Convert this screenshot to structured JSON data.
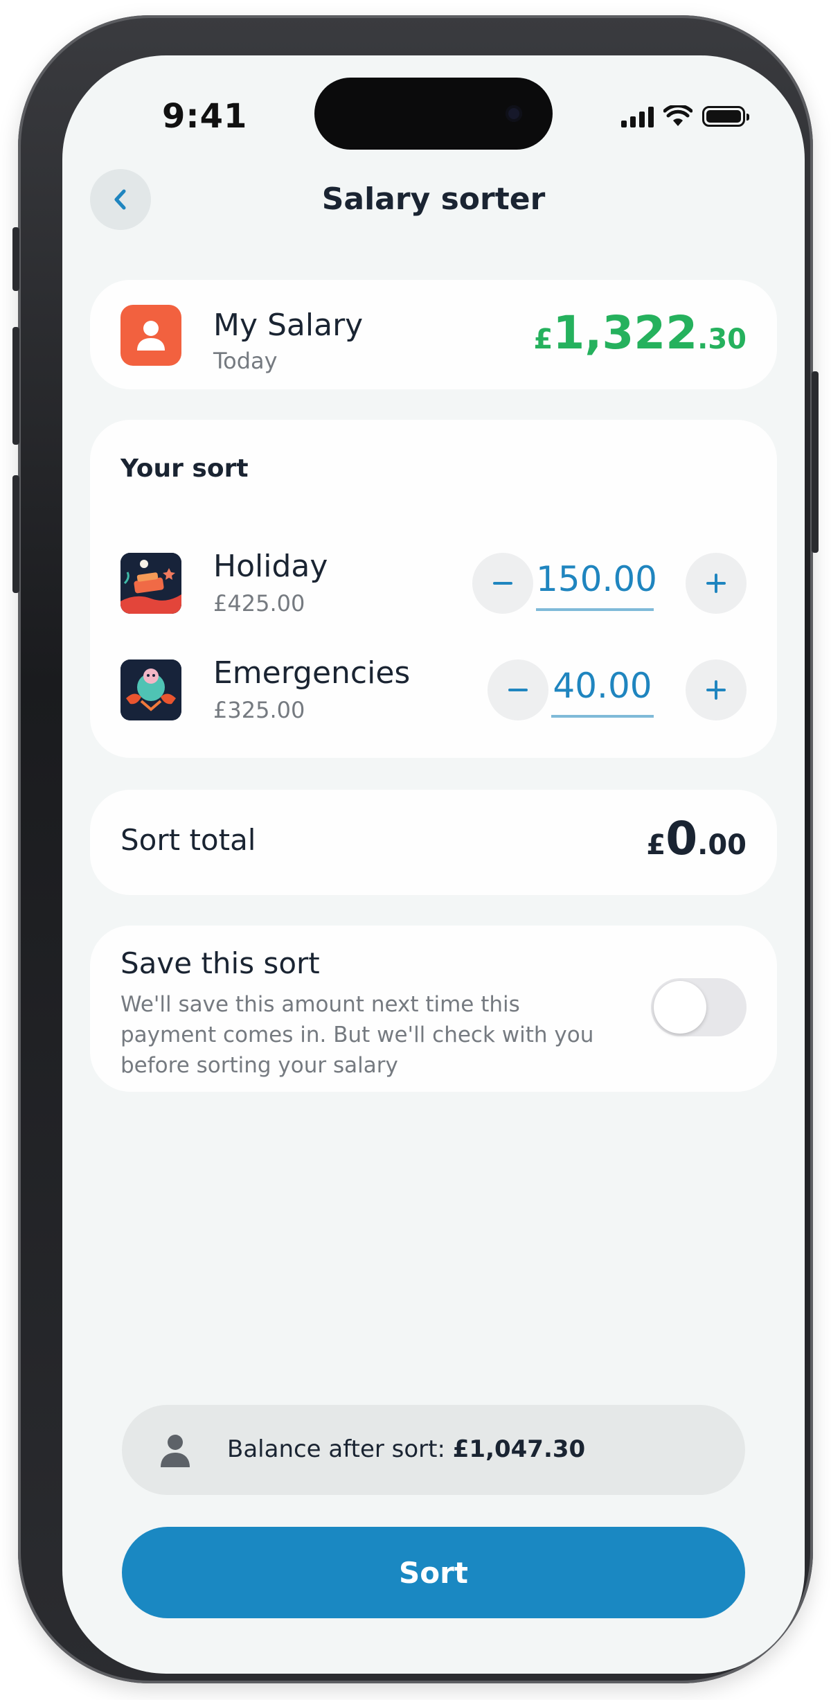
{
  "status_bar": {
    "time": "9:41",
    "icons": [
      "signal-icon",
      "wifi-icon",
      "battery-icon"
    ]
  },
  "header": {
    "back_icon": "chevron-left-icon",
    "title": "Salary sorter"
  },
  "salary": {
    "icon": "person-icon",
    "name": "My Salary",
    "date": "Today",
    "amount_currency": "£",
    "amount_main": "1,322",
    "amount_decimal": ".30",
    "color": "#25b15d"
  },
  "your_sort": {
    "heading": "Your sort",
    "pots": [
      {
        "name": "Holiday",
        "target": "£425.00",
        "amount": "150.00",
        "minus_icon": "minus-icon",
        "plus_icon": "plus-icon",
        "icon": "holiday-pot-icon"
      },
      {
        "name": "Emergencies",
        "target": "£325.00",
        "amount": "40.00",
        "minus_icon": "minus-icon",
        "plus_icon": "plus-icon",
        "icon": "emergencies-pot-icon"
      }
    ]
  },
  "sort_total": {
    "label": "Sort total",
    "currency": "£",
    "main": "0",
    "decimal": ".00"
  },
  "save_sort": {
    "title": "Save this sort",
    "description": "We'll save this amount next time this payment comes in. But we'll check with you before sorting your salary",
    "toggle_on": false
  },
  "balance": {
    "icon": "person-icon",
    "label": "Balance after sort:",
    "value": "£1,047.30"
  },
  "actions": {
    "sort_label": "Sort"
  },
  "colors": {
    "accent": "#1a88c2",
    "amount_blue": "#1f85bf",
    "positive_green": "#25b15d",
    "avatar_orange": "#f2613f",
    "background": "#f3f6f6"
  }
}
